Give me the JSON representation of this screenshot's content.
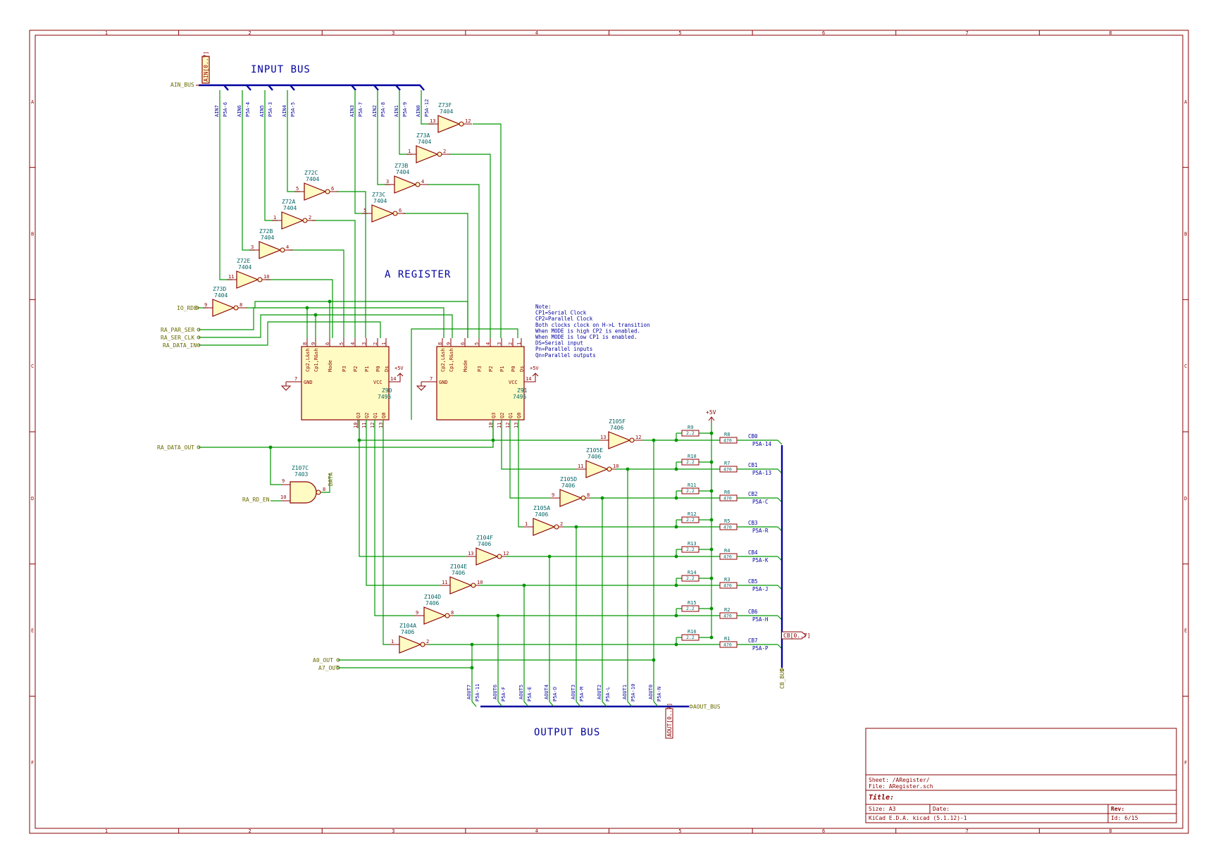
{
  "sheet": {
    "border_columns": [
      "1",
      "2",
      "3",
      "4",
      "5",
      "6",
      "7",
      "8"
    ],
    "border_rows": [
      "A",
      "B",
      "C",
      "D",
      "E",
      "F"
    ],
    "labels": {
      "input_bus": "INPUT BUS",
      "output_bus": "OUTPUT BUS",
      "a_register": "A REGISTER"
    },
    "colors": {
      "frame": "#8b0000",
      "wire": "#009600",
      "bus": "#0000a0",
      "component_fill": "#fffbc2",
      "reference": "#006464",
      "hier_label": "#6a6a00"
    }
  },
  "ports": {
    "ain_bus": "AIN_BUS",
    "ain_range": "AIN[0..7]",
    "io_rde": "IO_RDE",
    "ra_par_ser": "RA_PAR_SER",
    "ra_ser_clk": "RA_SER_CLK",
    "ra_data_in": "RA_DATA_IN",
    "ra_data_out": "RA_DATA_OUT",
    "ra_rd_en": "RA_RD_EN",
    "data": "DATA",
    "a0_out": "A0_OUT",
    "a7_out": "A7_OUT",
    "aout_bus": "AOUT_BUS",
    "aout_range": "AOUT[0..7]",
    "cb_bus": "CB_BUS",
    "cb_range": "CB[0..7]"
  },
  "input_taps": [
    {
      "net": "AIN7",
      "pin": "P5A-6"
    },
    {
      "net": "AIN6",
      "pin": "P5A-4"
    },
    {
      "net": "AIN5",
      "pin": "P5A-3"
    },
    {
      "net": "AIN4",
      "pin": "P5A-5"
    },
    {
      "net": "AIN3",
      "pin": "P5A-7"
    },
    {
      "net": "AIN2",
      "pin": "P5A-8"
    },
    {
      "net": "AIN1",
      "pin": "P5A-9"
    },
    {
      "net": "AIN0",
      "pin": "P5A-12"
    }
  ],
  "inverters_in": [
    {
      "ref": "Z73F",
      "part": "7404",
      "in": "13",
      "out": "12"
    },
    {
      "ref": "Z73A",
      "part": "7404",
      "in": "1",
      "out": "2"
    },
    {
      "ref": "Z73B",
      "part": "7404",
      "in": "3",
      "out": "4"
    },
    {
      "ref": "Z73C",
      "part": "7404",
      "in": "5",
      "out": "6"
    },
    {
      "ref": "Z72C",
      "part": "7404",
      "in": "5",
      "out": "6"
    },
    {
      "ref": "Z72A",
      "part": "7404",
      "in": "1",
      "out": "2"
    },
    {
      "ref": "Z72B",
      "part": "7404",
      "in": "3",
      "out": "4"
    },
    {
      "ref": "Z72E",
      "part": "7404",
      "in": "11",
      "out": "10"
    },
    {
      "ref": "Z73D",
      "part": "7404",
      "in": "9",
      "out": "8"
    }
  ],
  "registers": [
    {
      "ref": "Z90",
      "part": "7495",
      "top_labels": [
        "Cp2,L&sh",
        "Cp1,R&sh",
        "Mode",
        "P3",
        "P2",
        "P1",
        "P0",
        "Ds"
      ],
      "top_pins": [
        "8",
        "9",
        "6",
        "5",
        "4",
        "3",
        "2",
        "1"
      ],
      "gnd": "GND",
      "gnd_pin": "7",
      "vcc": "VCC",
      "vcc_pin": "14",
      "supply": "+5V",
      "bottom_labels": [
        "Q3",
        "Q2",
        "Q1",
        "Q0"
      ],
      "bottom_pins": [
        "10",
        "11",
        "12",
        "13"
      ]
    },
    {
      "ref": "Z91",
      "part": "7495",
      "top_labels": [
        "Cp2,L&sh",
        "Cp1,R&sh",
        "Mode",
        "P3",
        "P2",
        "P1",
        "P0",
        "Ds"
      ],
      "top_pins": [
        "8",
        "9",
        "6",
        "5",
        "4",
        "3",
        "2",
        "1"
      ],
      "gnd": "GND",
      "gnd_pin": "7",
      "vcc": "VCC",
      "vcc_pin": "14",
      "supply": "+5V",
      "bottom_labels": [
        "Q3",
        "Q2",
        "Q1",
        "Q0"
      ],
      "bottom_pins": [
        "10",
        "11",
        "12",
        "13"
      ]
    }
  ],
  "note": [
    "Note:",
    "CP1=Serial Clock",
    "CP2=Parallel Clock",
    "Both clocks clock on H->L transition",
    "When MODE is high CP2 is enabled.",
    "When MODE is low CP1 is enabled.",
    "DS=Serial input",
    "Pn=Parallel inputs",
    "Qn=Parallel outputs"
  ],
  "nand_gate": {
    "ref": "Z107C",
    "part": "7403",
    "in_a": "9",
    "in_b": "10",
    "out": "8"
  },
  "drivers_top": [
    {
      "ref": "Z105F",
      "part": "7406",
      "in": "13",
      "out": "12"
    },
    {
      "ref": "Z105E",
      "part": "7406",
      "in": "11",
      "out": "10"
    },
    {
      "ref": "Z105D",
      "part": "7406",
      "in": "9",
      "out": "8"
    },
    {
      "ref": "Z105A",
      "part": "7406",
      "in": "1",
      "out": "2"
    }
  ],
  "drivers_bottom": [
    {
      "ref": "Z104F",
      "part": "7406",
      "in": "13",
      "out": "12"
    },
    {
      "ref": "Z104E",
      "part": "7406",
      "in": "11",
      "out": "10"
    },
    {
      "ref": "Z104D",
      "part": "7406",
      "in": "9",
      "out": "8"
    },
    {
      "ref": "Z104A",
      "part": "7406",
      "in": "1",
      "out": "2"
    }
  ],
  "vcc_label": "+5V",
  "resistors": [
    {
      "pullup": "R9",
      "pullup_val": "2.2",
      "series": "R8",
      "series_val": "470",
      "net": "CB0",
      "pin": "P5A-14"
    },
    {
      "pullup": "R10",
      "pullup_val": "2.2",
      "series": "R7",
      "series_val": "470",
      "net": "CB1",
      "pin": "P5A-13"
    },
    {
      "pullup": "R11",
      "pullup_val": "2.2",
      "series": "R6",
      "series_val": "470",
      "net": "CB2",
      "pin": "P5A-C"
    },
    {
      "pullup": "R12",
      "pullup_val": "2.2",
      "series": "R5",
      "series_val": "470",
      "net": "CB3",
      "pin": "P5A-R"
    },
    {
      "pullup": "R13",
      "pullup_val": "2.2",
      "series": "R4",
      "series_val": "470",
      "net": "CB4",
      "pin": "P5A-K"
    },
    {
      "pullup": "R14",
      "pullup_val": "2.2",
      "series": "R3",
      "series_val": "470",
      "net": "CB5",
      "pin": "P5A-J"
    },
    {
      "pullup": "R15",
      "pullup_val": "2.2",
      "series": "R2",
      "series_val": "470",
      "net": "CB6",
      "pin": "P5A-H"
    },
    {
      "pullup": "R16",
      "pullup_val": "2.2",
      "series": "R1",
      "series_val": "470",
      "net": "CB7",
      "pin": "P5A-P"
    }
  ],
  "output_taps": [
    {
      "net": "AOUT7",
      "pin": "P5A-11"
    },
    {
      "net": "AOUT6",
      "pin": "P5A-F"
    },
    {
      "net": "AOUT5",
      "pin": "P5A-E"
    },
    {
      "net": "AOUT4",
      "pin": "P5A-D"
    },
    {
      "net": "AOUT3",
      "pin": "P5A-M"
    },
    {
      "net": "AOUT2",
      "pin": "P5A-L"
    },
    {
      "net": "AOUT1",
      "pin": "P5A-10"
    },
    {
      "net": "AOUT0",
      "pin": "P5A-N"
    }
  ],
  "title_block": {
    "sheet": "Sheet: /ARegister/",
    "file": "File: ARegister.sch",
    "title": "Title:",
    "size": "Size: A3",
    "date": "Date:",
    "rev": "Rev:",
    "tool": "KiCad E.D.A.  kicad (5.1.12)-1",
    "id": "Id: 6/15"
  }
}
